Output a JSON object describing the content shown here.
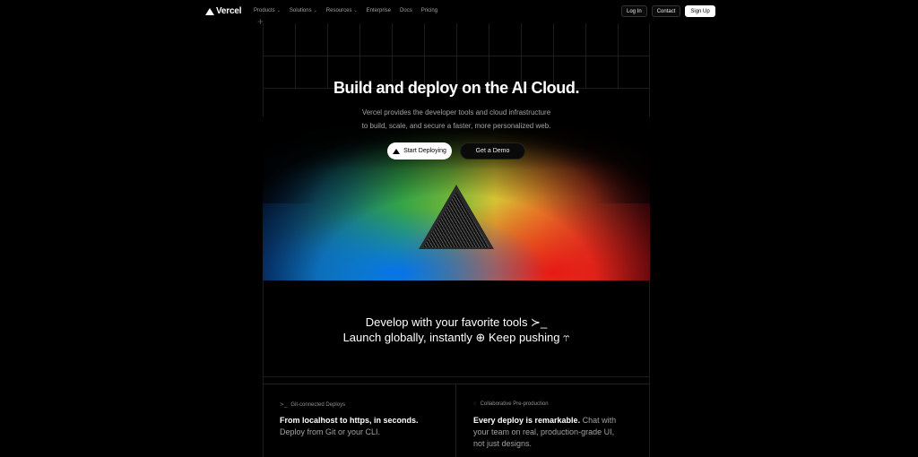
{
  "nav": {
    "brand": "Vercel",
    "links": [
      {
        "label": "Products",
        "dropdown": true
      },
      {
        "label": "Solutions",
        "dropdown": true
      },
      {
        "label": "Resources",
        "dropdown": true
      },
      {
        "label": "Enterprise",
        "dropdown": false
      },
      {
        "label": "Docs",
        "dropdown": false
      },
      {
        "label": "Pricing",
        "dropdown": false
      }
    ],
    "login": "Log In",
    "contact": "Contact",
    "signup": "Sign Up"
  },
  "hero": {
    "title": "Build and deploy on the AI Cloud.",
    "subtitle_line1": "Vercel provides the developer tools and cloud infrastructure",
    "subtitle_line2": "to build, scale, and secure a faster, more personalized web.",
    "cta_primary": "Start Deploying",
    "cta_secondary": "Get a Demo"
  },
  "tagline": {
    "line1": "Develop with your favorite tools ≻_",
    "line2": "Launch globally, instantly ⊕ Keep pushing ⥾"
  },
  "features": [
    {
      "tag": "Git-connected Deploys",
      "icon": "terminal-icon",
      "headline": "From localhost to https, in seconds.",
      "body": "Deploy from Git or your CLI."
    },
    {
      "tag": "Collaborative Pre-production",
      "icon": "comment-icon",
      "headline": "Every deploy is remarkable.",
      "body": "Chat with your team on real, production-grade UI, not just designs."
    }
  ]
}
